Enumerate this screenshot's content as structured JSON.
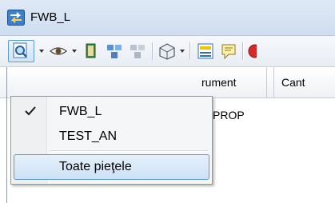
{
  "window": {
    "title": "FWB_L"
  },
  "grid": {
    "columns": [
      "rument",
      "Cant"
    ],
    "rows": [
      [
        "PROP"
      ]
    ]
  },
  "menu": {
    "items": [
      {
        "label": "FWB_L",
        "checked": true
      },
      {
        "label": "TEST_AN",
        "checked": false
      },
      {
        "label": "Toate pieţele",
        "checked": false,
        "highlighted": true
      }
    ]
  },
  "toolbar": {
    "icons": [
      "view-filter-icon",
      "eye-icon",
      "book-icon",
      "portfolio-icon",
      "portfolio-disabled-icon",
      "workspace-icon",
      "chart-layout-icon",
      "notes-icon",
      "stop-icon"
    ]
  },
  "colors": {
    "highlight_border": "#5d99d2",
    "titlebar": "#dfe9f6"
  }
}
